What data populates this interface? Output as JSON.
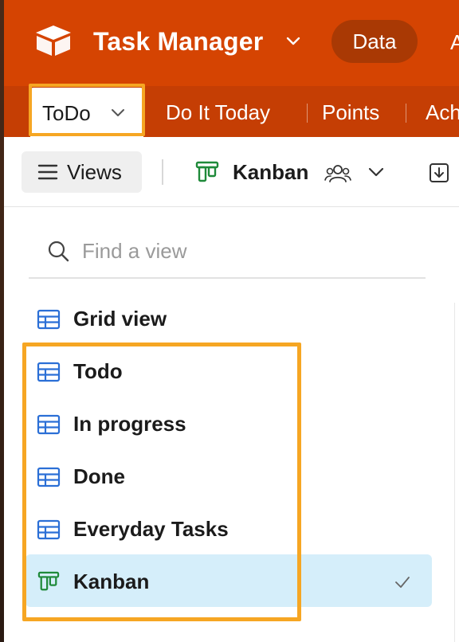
{
  "header": {
    "app_title": "Task Manager",
    "data_button": "Data",
    "overflow_text": "A",
    "logo_icon": "cube-logo-icon",
    "brand_color": "#d54402"
  },
  "tabs": {
    "active": "ToDo",
    "items": [
      "Do It Today",
      "Points",
      "Ach"
    ]
  },
  "viewbar": {
    "views_label": "Views",
    "current_view": "Kanban",
    "icons": [
      "hamburger-menu-icon",
      "kanban-icon",
      "people-icon",
      "chevron-down-icon",
      "download-icon"
    ]
  },
  "view_picker": {
    "search_placeholder": "Find a view",
    "search_value": "",
    "items": [
      {
        "label": "Grid view",
        "icon": "grid-icon",
        "selected": false
      },
      {
        "label": "Todo",
        "icon": "grid-icon",
        "selected": false
      },
      {
        "label": "In progress",
        "icon": "grid-icon",
        "selected": false
      },
      {
        "label": "Done",
        "icon": "grid-icon",
        "selected": false
      },
      {
        "label": "Everyday Tasks",
        "icon": "grid-icon",
        "selected": false
      },
      {
        "label": "Kanban",
        "icon": "kanban-icon",
        "selected": true
      }
    ]
  },
  "colors": {
    "highlight": "#f6a623",
    "grid_icon": "#2b6fd6",
    "kanban_icon": "#1f8a3a",
    "selected_row": "#d5eefa"
  }
}
